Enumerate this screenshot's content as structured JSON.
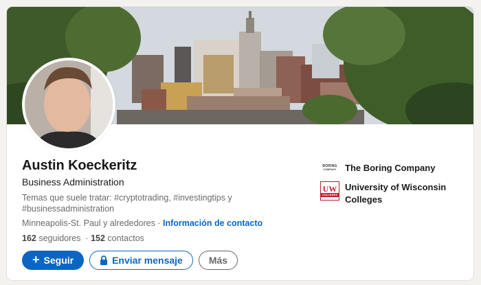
{
  "profile": {
    "name": "Austin Koeckeritz",
    "headline": "Business Administration",
    "topics": "Temas que suele tratar: #cryptotrading, #investingtips y #businessadministration",
    "location": "Minneapolis-St. Paul y alrededores",
    "separator": " · ",
    "contact_link": "Información de contacto",
    "followers_count": "162",
    "followers_label": " seguidores",
    "stats_separator": "  · ",
    "connections_count": "152",
    "connections_label": " contactos"
  },
  "actions": {
    "follow_label": "Seguir",
    "message_label": "Enviar mensaje",
    "more_label": "Más"
  },
  "orgs": [
    {
      "name": "The Boring Company",
      "logo": "boring-company-logo",
      "logo_text_top": "BORING",
      "logo_text_bottom": "COMPANY"
    },
    {
      "name": "University of Wisconsin Colleges",
      "logo": "uw-colleges-logo",
      "logo_mark": "UW",
      "logo_bar": "COLLEGES"
    }
  ],
  "icons": {
    "follow": "plus-icon",
    "message": "lock-icon"
  },
  "colors": {
    "brand_blue": "#0a66c2",
    "uw_red": "#c0202f",
    "page_bg": "#f3f2ef"
  }
}
